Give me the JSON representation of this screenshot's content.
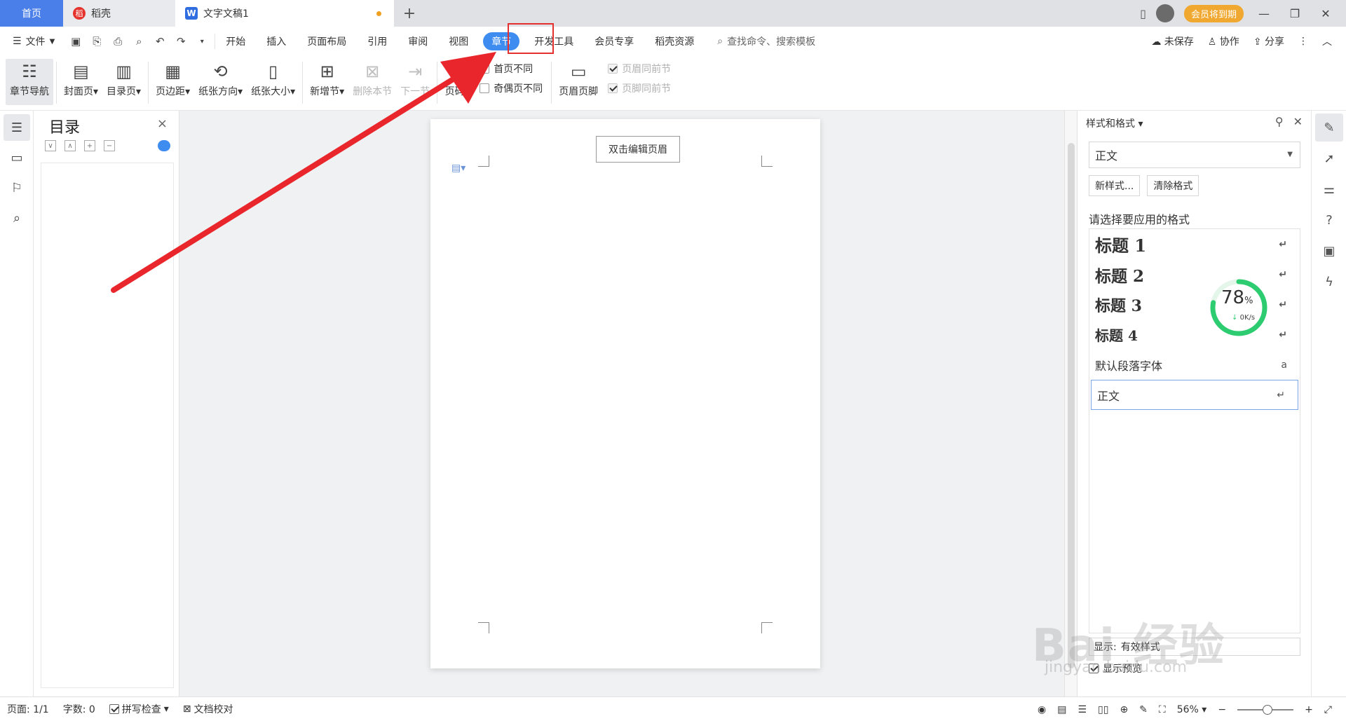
{
  "tabs": {
    "home": "首页",
    "daoke": "稻壳",
    "doc": "文字文稿1",
    "add": "+",
    "daoke_badge": "稻",
    "doc_badge": "W"
  },
  "titlebar": {
    "vip_label": "会员将到期",
    "minimize": "—",
    "restore": "❐",
    "close": "✕"
  },
  "menu": {
    "file": "文件",
    "items": [
      "开始",
      "插入",
      "页面布局",
      "引用",
      "审阅",
      "视图",
      "章节",
      "开发工具",
      "会员专享",
      "稻壳资源"
    ],
    "active": "章节",
    "search": "查找命令、搜索模板",
    "unsaved": "未保存",
    "collab": "协作",
    "share": "分享"
  },
  "ribbon": {
    "nav": "章节导航",
    "cover": "封面页",
    "toc": "目录页",
    "margin": "页边距",
    "orientation": "纸张方向",
    "size": "纸张大小",
    "new_section": "新增节",
    "delete_section": "删除本节",
    "next_section": "下一节",
    "page_number": "页码",
    "first_diff": "首页不同",
    "odd_even_diff": "奇偶页不同",
    "header_footer": "页眉页脚",
    "header_same": "页眉同前节",
    "footer_same": "页脚同前节"
  },
  "toc_panel": {
    "title": "目录",
    "close": "×"
  },
  "document": {
    "header_tip": "双击编辑页眉"
  },
  "styles_panel": {
    "title": "样式和格式",
    "current": "正文",
    "new_style": "新样式...",
    "clear_format": "清除格式",
    "prompt": "请选择要应用的格式",
    "items": [
      {
        "label": "标题 1",
        "mark": "↵"
      },
      {
        "label": "标题 2",
        "mark": "↵"
      },
      {
        "label": "标题 3",
        "mark": "↵"
      },
      {
        "label": "标题 4",
        "mark": "↵"
      },
      {
        "label": "默认段落字体",
        "mark": "a"
      },
      {
        "label": "正文",
        "mark": "↵"
      }
    ],
    "show_label": "显示:",
    "show_value": "有效样式",
    "preview": "显示预览"
  },
  "net_gauge": {
    "percent": "78",
    "percent_value": 78,
    "percent_sign": "%",
    "speed": "0K/s"
  },
  "statusbar": {
    "page": "页面: 1/1",
    "words": "字数: 0",
    "spell": "拼写检查",
    "proof": "文档校对",
    "zoom": "56%",
    "zoom_value": 56
  },
  "watermark": {
    "brand": "Bai 经验",
    "url": "jingyan.baidu.com"
  },
  "colors": {
    "accent": "#3f8cf0",
    "highlight_box": "#e53030",
    "arrow": "#e8262b",
    "gauge": "#2ecc71",
    "vip": "#f0a830"
  }
}
